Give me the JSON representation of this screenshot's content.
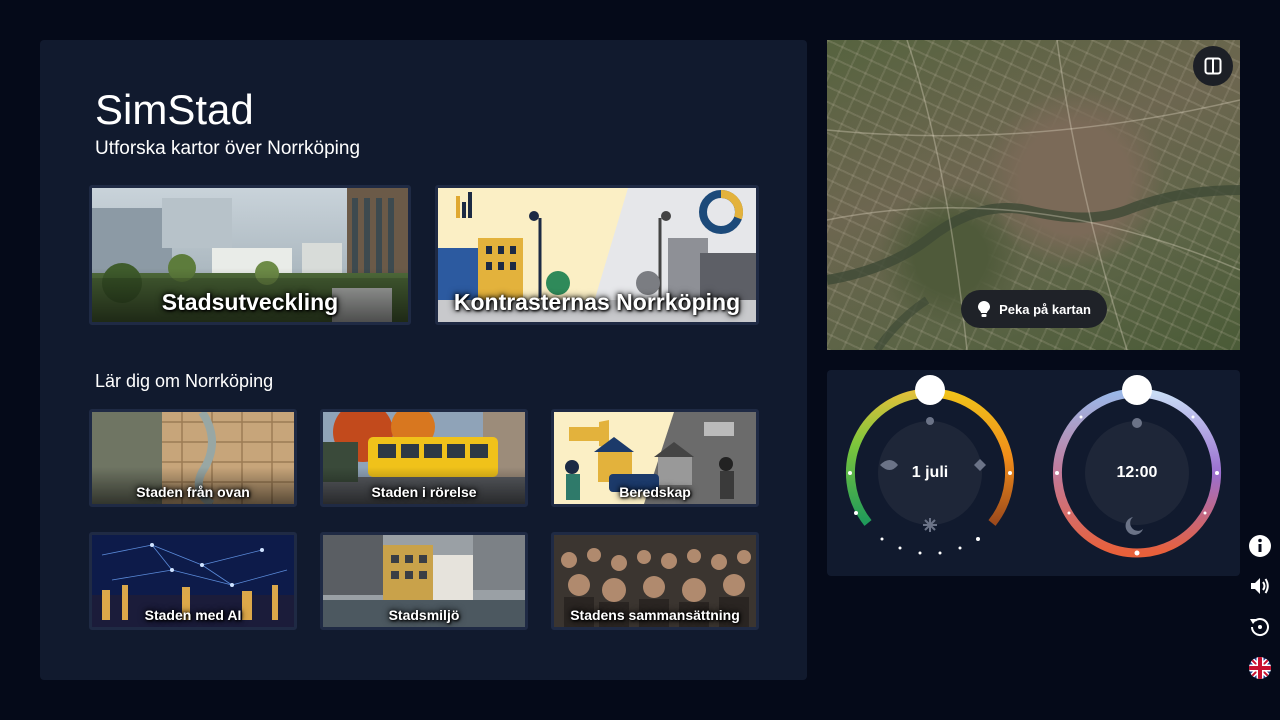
{
  "app": {
    "title": "SimStad",
    "subtitle": "Utforska kartor över Norrköping"
  },
  "featured": [
    {
      "label": "Stadsutveckling"
    },
    {
      "label": "Kontrasternas Norrköping"
    }
  ],
  "learn": {
    "heading": "Lär dig om Norrköping",
    "items": [
      {
        "label": "Staden från ovan"
      },
      {
        "label": "Staden i rörelse"
      },
      {
        "label": "Beredskap"
      },
      {
        "label": "Staden med AI"
      },
      {
        "label": "Stadsmiljö"
      },
      {
        "label": "Stadens sammansättning"
      }
    ]
  },
  "map": {
    "point_label": "Peka på kartan",
    "toggle_icon": "split-view-icon"
  },
  "season_dial": {
    "value": "1 juli",
    "icons": [
      "sun-icon",
      "leaf-icon",
      "sprout-icon",
      "snowflake-icon"
    ]
  },
  "time_dial": {
    "value": "12:00",
    "icons": [
      "sun-icon",
      "moon-icon"
    ]
  },
  "side_menu": [
    "info-icon",
    "speaker-icon",
    "reset-icon",
    "uk-flag-icon"
  ]
}
